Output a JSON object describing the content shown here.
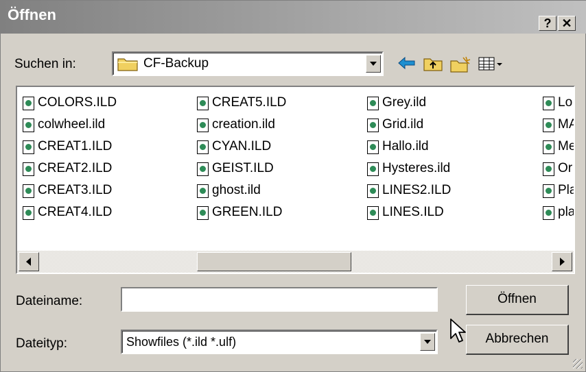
{
  "window": {
    "title": "Öffnen",
    "help_glyph": "?",
    "close_glyph": "✕"
  },
  "toolbar": {
    "look_in_label": "Suchen in:",
    "look_in_value": "CF-Backup",
    "icons": [
      "back-arrow-icon",
      "up-folder-icon",
      "new-folder-icon",
      "view-menu-icon"
    ]
  },
  "files": [
    [
      "COLORS.ILD",
      "colwheel.ild",
      "CREAT1.ILD",
      "CREAT2.ILD",
      "CREAT3.ILD",
      "CREAT4.ILD"
    ],
    [
      "CREAT5.ILD",
      "creation.ild",
      "CYAN.ILD",
      "GEIST.ILD",
      "ghost.ild",
      "GREEN.ILD"
    ],
    [
      "Grey.ild",
      "Grid.ild",
      "Hallo.ild",
      "Hysteres.ild",
      "LINES2.ILD",
      "LINES.ILD"
    ],
    [
      "Lo",
      "MA",
      "Me",
      "Or",
      "Pla",
      "pla"
    ]
  ],
  "filename": {
    "label": "Dateiname:",
    "value": ""
  },
  "filetype": {
    "label": "Dateityp:",
    "value": "Showfiles (*.ild *.ulf)"
  },
  "buttons": {
    "open": "Öffnen",
    "cancel": "Abbrechen"
  },
  "colors": {
    "titlebar": "#a0a0a0",
    "face": "#d4d0c8",
    "file_icon": "#2e8b57",
    "folder": "#f0d060"
  }
}
